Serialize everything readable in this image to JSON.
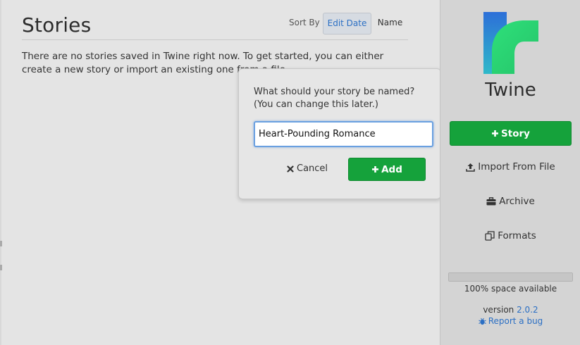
{
  "main": {
    "title": "Stories",
    "sort_label": "Sort By",
    "sort_options": [
      {
        "label": "Edit Date",
        "active": true
      },
      {
        "label": "Name",
        "active": false
      }
    ],
    "empty_message": "There are no stories saved in Twine right now. To get started, you can either create a new story or import an existing one from a file."
  },
  "popup": {
    "prompt_line1": "What should your story be named?",
    "prompt_line2": "(You can change this later.)",
    "input_value": "Heart-Pounding Romance",
    "cancel_label": "Cancel",
    "add_label": "Add"
  },
  "sidebar": {
    "app_name": "Twine",
    "story_button": "Story",
    "import_label": "Import From File",
    "archive_label": "Archive",
    "formats_label": "Formats",
    "space_available": "100% space available",
    "space_fraction": 1.0,
    "version_prefix": "version",
    "version_number": "2.0.2",
    "report_bug": "Report a bug"
  },
  "colors": {
    "accent_green": "#15a23b",
    "link_blue": "#2b6fc4",
    "logo_blue": "#2d6fd8",
    "logo_green": "#2ee07a"
  },
  "icons": [
    "plus-icon",
    "close-icon",
    "upload-icon",
    "briefcase-icon",
    "copy-icon",
    "bug-icon"
  ]
}
